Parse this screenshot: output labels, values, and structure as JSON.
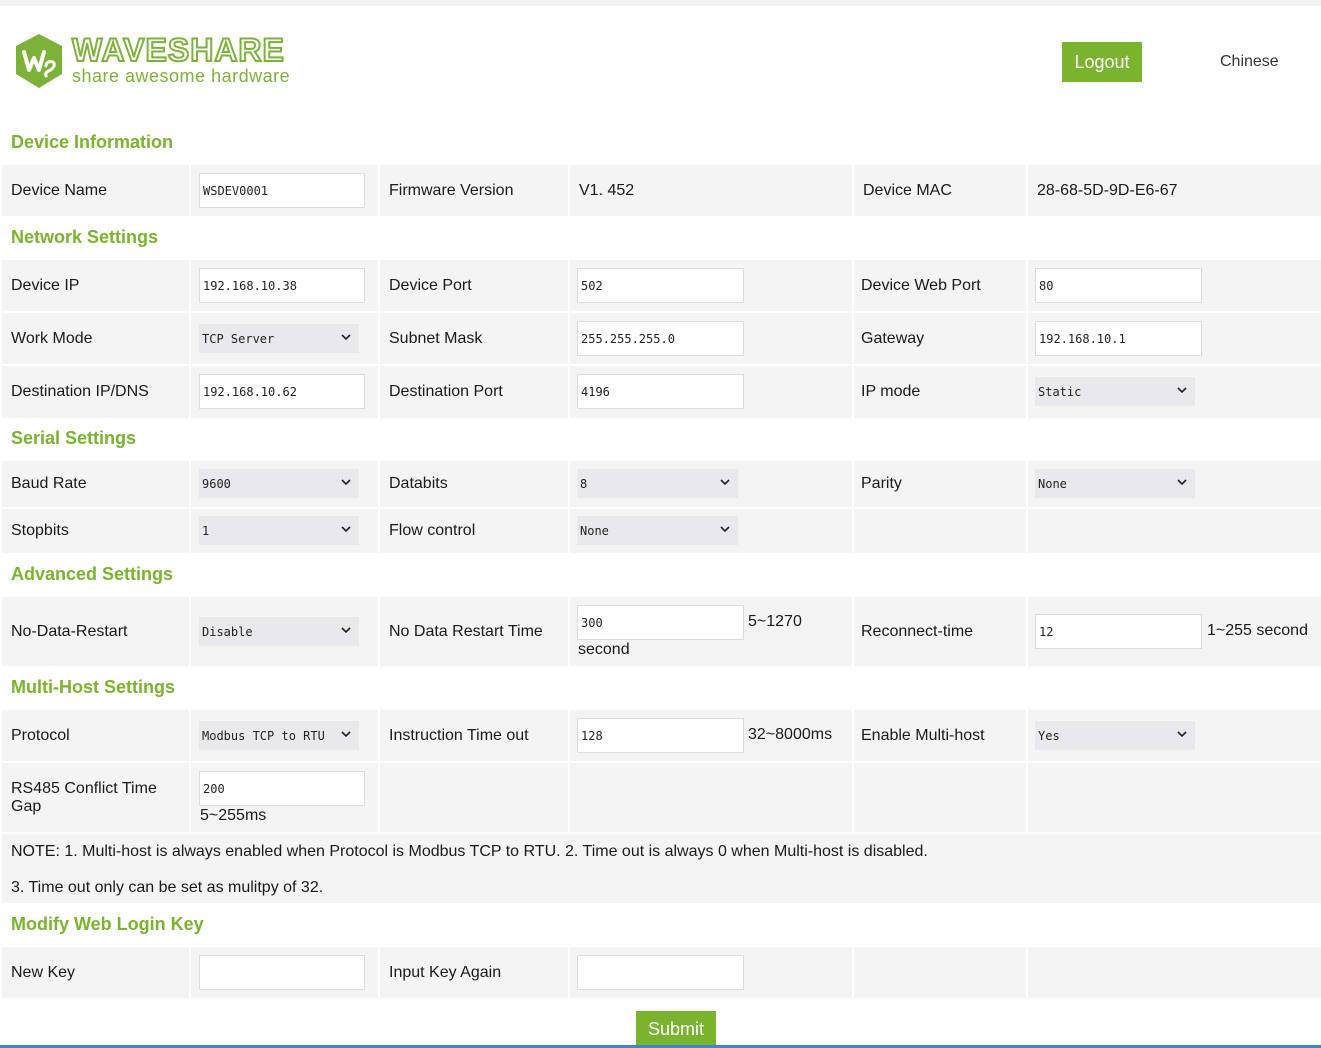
{
  "header": {
    "brand": "WAVESHARE",
    "tagline": "share awesome hardware",
    "logout_label": "Logout",
    "language_label": "Chinese",
    "brand_color": "#7ab32e"
  },
  "sections": {
    "device_info": "Device Information",
    "network": "Network Settings",
    "serial": "Serial Settings",
    "advanced": "Advanced Settings",
    "multi_host": "Multi-Host Settings",
    "login_key": "Modify Web Login Key"
  },
  "device_info": {
    "name_label": "Device Name",
    "name_value": "WSDEV0001",
    "fw_label": "Firmware Version",
    "fw_value": "V1. 452",
    "mac_label": "Device MAC",
    "mac_value": "28-68-5D-9D-E6-67"
  },
  "network": {
    "ip_label": "Device IP",
    "ip_value": "192.168.10.38",
    "port_label": "Device Port",
    "port_value": "502",
    "web_port_label": "Device Web Port",
    "web_port_value": "80",
    "work_mode_label": "Work Mode",
    "work_mode_value": "TCP Server",
    "subnet_label": "Subnet Mask",
    "subnet_value": "255.255.255.0",
    "gateway_label": "Gateway",
    "gateway_value": "192.168.10.1",
    "dest_ip_label": "Destination IP/DNS",
    "dest_ip_value": "192.168.10.62",
    "dest_port_label": "Destination Port",
    "dest_port_value": "4196",
    "ip_mode_label": "IP mode",
    "ip_mode_value": "Static"
  },
  "serial": {
    "baud_label": "Baud Rate",
    "baud_value": "9600",
    "databits_label": "Databits",
    "databits_value": "8",
    "parity_label": "Parity",
    "parity_value": "None",
    "stopbits_label": "Stopbits",
    "stopbits_value": "1",
    "flow_label": "Flow control",
    "flow_value": "None"
  },
  "advanced": {
    "ndr_label": "No-Data-Restart",
    "ndr_value": "Disable",
    "ndr_time_label": "No Data Restart Time",
    "ndr_time_value": "300",
    "ndr_time_range": "5~1270",
    "ndr_time_unit": "second",
    "reconnect_label": "Reconnect-time",
    "reconnect_value": "12",
    "reconnect_range": "1~255 second"
  },
  "multi_host": {
    "protocol_label": "Protocol",
    "protocol_value": "Modbus TCP to RTU",
    "timeout_label": "Instruction Time out",
    "timeout_value": "128",
    "timeout_range": "32~8000ms",
    "enable_label": "Enable Multi-host",
    "enable_value": "Yes",
    "conflict_label": "RS485 Conflict Time Gap",
    "conflict_value": "200",
    "conflict_range": "5~255ms",
    "note1": "NOTE: 1. Multi-host is always enabled when Protocol is Modbus TCP to RTU. 2. Time out is always 0 when Multi-host is disabled.",
    "note2": "3. Time out only can be set as mulitpy of 32."
  },
  "login_key": {
    "new_key_label": "New Key",
    "new_key_value": "",
    "again_label": "Input Key Again",
    "again_value": ""
  },
  "submit_label": "Submit"
}
